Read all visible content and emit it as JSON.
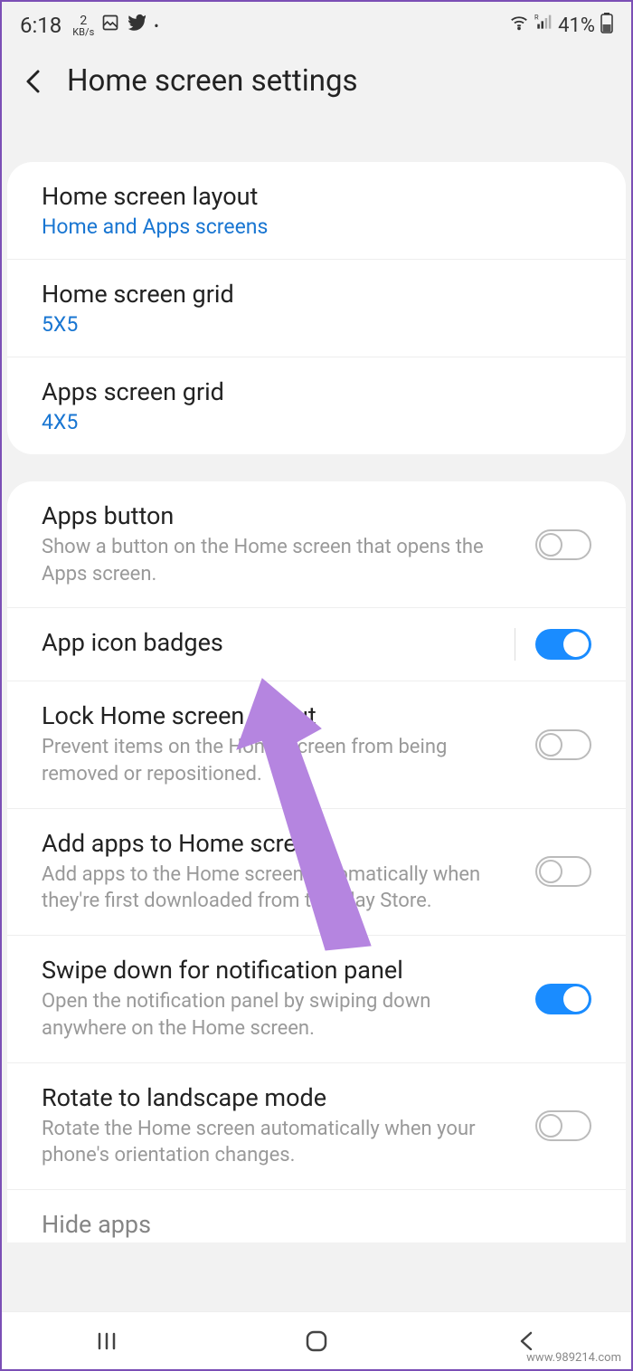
{
  "status": {
    "time": "6:18",
    "net_rate": "2",
    "net_unit": "KB/s",
    "battery_pct": "41%"
  },
  "header": {
    "title": "Home screen settings"
  },
  "group1": {
    "layout": {
      "title": "Home screen layout",
      "value": "Home and Apps screens"
    },
    "home_grid": {
      "title": "Home screen grid",
      "value": "5X5"
    },
    "apps_grid": {
      "title": "Apps screen grid",
      "value": "4X5"
    }
  },
  "group2": {
    "apps_button": {
      "title": "Apps button",
      "desc": "Show a button on the Home screen that opens the Apps screen.",
      "on": false
    },
    "icon_badges": {
      "title": "App icon badges",
      "on": true
    },
    "lock_layout": {
      "title": "Lock Home screen layout",
      "desc": "Prevent items on the Home screen from being removed or repositioned.",
      "on": false
    },
    "add_apps": {
      "title": "Add apps to Home screen",
      "desc": "Add apps to the Home screen automatically when they're first downloaded from the Play Store.",
      "on": false
    },
    "swipe_notif": {
      "title": "Swipe down for notification panel",
      "desc": "Open the notification panel by swiping down anywhere on the Home screen.",
      "on": true
    },
    "rotate": {
      "title": "Rotate to landscape mode",
      "desc": "Rotate the Home screen automatically when your phone's orientation changes.",
      "on": false
    },
    "hide_apps": {
      "title": "Hide apps"
    }
  },
  "watermark": "www.989214.com"
}
